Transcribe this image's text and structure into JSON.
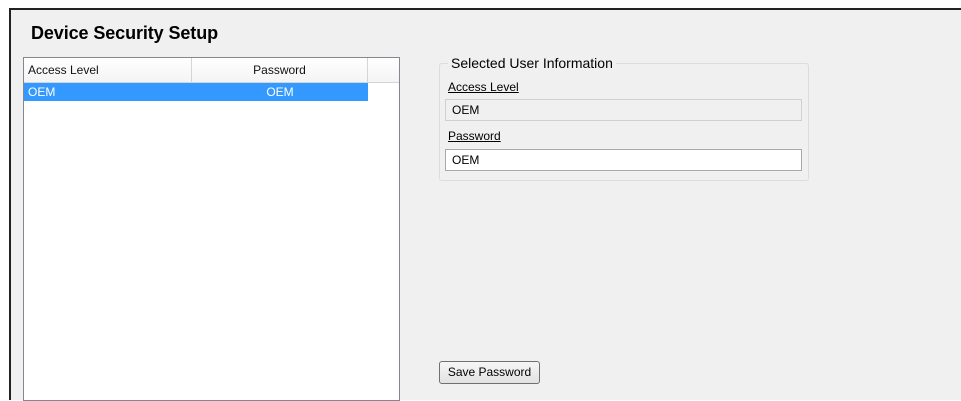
{
  "page": {
    "title": "Device Security Setup"
  },
  "user_list": {
    "columns": [
      "Access Level",
      "Password"
    ],
    "rows": [
      {
        "access_level": "OEM",
        "password": "OEM",
        "selected": true
      }
    ]
  },
  "selected_user": {
    "group_title": "Selected User Information",
    "access_level_label": "Access Level",
    "access_level_value": "OEM",
    "password_label": "Password",
    "password_value": "OEM"
  },
  "actions": {
    "save_password_label": "Save Password"
  },
  "colors": {
    "selection_highlight": "#3399ff",
    "panel_background": "#f0f0f0"
  }
}
